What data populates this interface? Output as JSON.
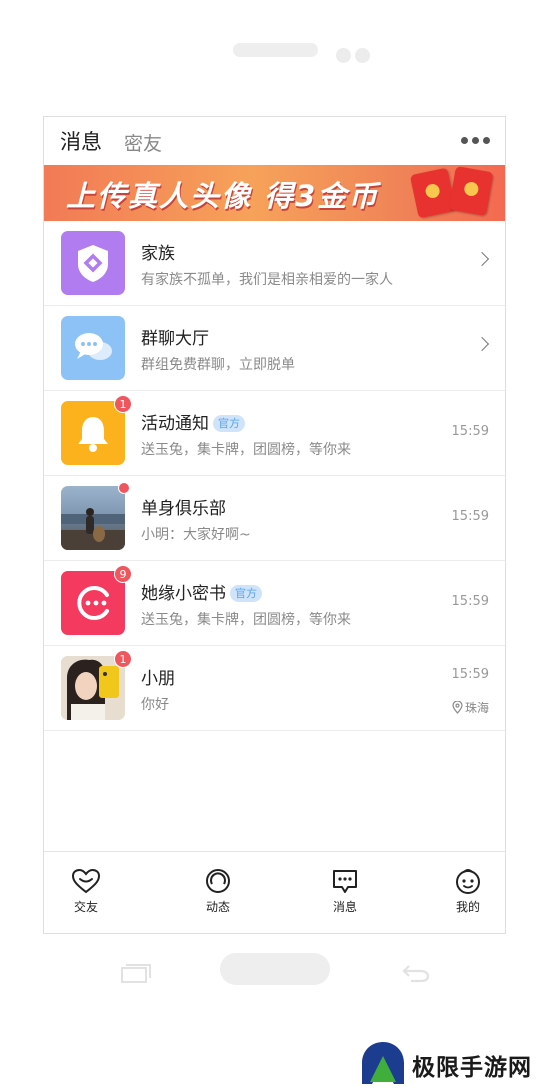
{
  "header": {
    "tabs": [
      {
        "label": "消息",
        "active": true
      },
      {
        "label": "密友",
        "active": false
      }
    ]
  },
  "banner": {
    "text": "上传真人头像 得3金币"
  },
  "messages": [
    {
      "title": "家族",
      "subtitle": "有家族不孤单，我们是相亲相爱的一家人",
      "icon": "shield-icon",
      "color": "#b07cf0",
      "arrow": true
    },
    {
      "title": "群聊大厅",
      "subtitle": "群组免费群聊，立即脱单",
      "icon": "chat-bubbles-icon",
      "color": "#8dc2f7",
      "arrow": true
    },
    {
      "title": "活动通知",
      "tag": "官方",
      "subtitle": "送玉兔，集卡牌，团圆榜，等你来",
      "time": "15:59",
      "badge": "1",
      "icon": "bell-icon",
      "color": "#fbb21c"
    },
    {
      "title": "单身俱乐部",
      "subtitle": "小明：大家好啊~",
      "time": "15:59",
      "dot": true,
      "icon": "beach-photo"
    },
    {
      "title": "她缘小密书",
      "tag": "官方",
      "subtitle": "送玉兔，集卡牌，团圆榜，等你来",
      "time": "15:59",
      "badge": "9",
      "icon": "smile-face-icon",
      "color": "#f53a5f"
    },
    {
      "title": "小朋",
      "subtitle": "你好",
      "time": "15:59",
      "badge": "1",
      "location": "珠海",
      "icon": "selfie-photo"
    }
  ],
  "bottom_nav": [
    {
      "label": "交友",
      "icon": "heart-icon"
    },
    {
      "label": "动态",
      "icon": "ring-icon"
    },
    {
      "label": "消息",
      "icon": "message-icon"
    },
    {
      "label": "我的",
      "icon": "face-icon"
    }
  ],
  "watermark": {
    "text": "极限手游网"
  }
}
